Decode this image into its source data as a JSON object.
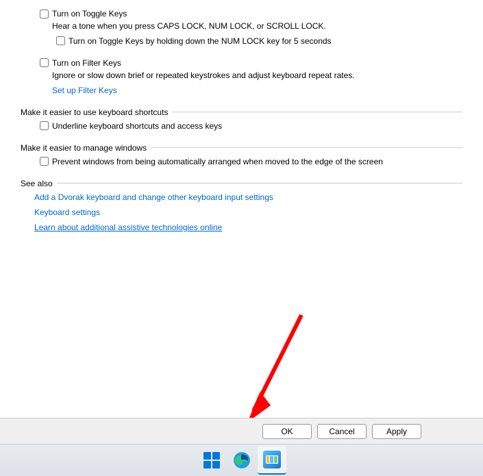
{
  "toggleKeys": {
    "label": "Turn on Toggle Keys",
    "desc": "Hear a tone when you press CAPS LOCK, NUM LOCK, or SCROLL LOCK.",
    "subLabel": "Turn on Toggle Keys by holding down the NUM LOCK key for 5 seconds"
  },
  "filterKeys": {
    "label": "Turn on Filter Keys",
    "desc": "Ignore or slow down brief or repeated keystrokes and adjust keyboard repeat rates.",
    "link": "Set up Filter Keys"
  },
  "sections": {
    "shortcuts": {
      "title": "Make it easier to use keyboard shortcuts",
      "checkbox": "Underline keyboard shortcuts and access keys"
    },
    "windows": {
      "title": "Make it easier to manage windows",
      "checkbox": "Prevent windows from being automatically arranged when moved to the edge of the screen"
    },
    "seeAlso": {
      "title": "See also",
      "links": [
        "Add a Dvorak keyboard and change other keyboard input settings",
        "Keyboard settings",
        "Learn about additional assistive technologies online"
      ]
    }
  },
  "buttons": {
    "ok": "OK",
    "cancel": "Cancel",
    "apply": "Apply"
  }
}
